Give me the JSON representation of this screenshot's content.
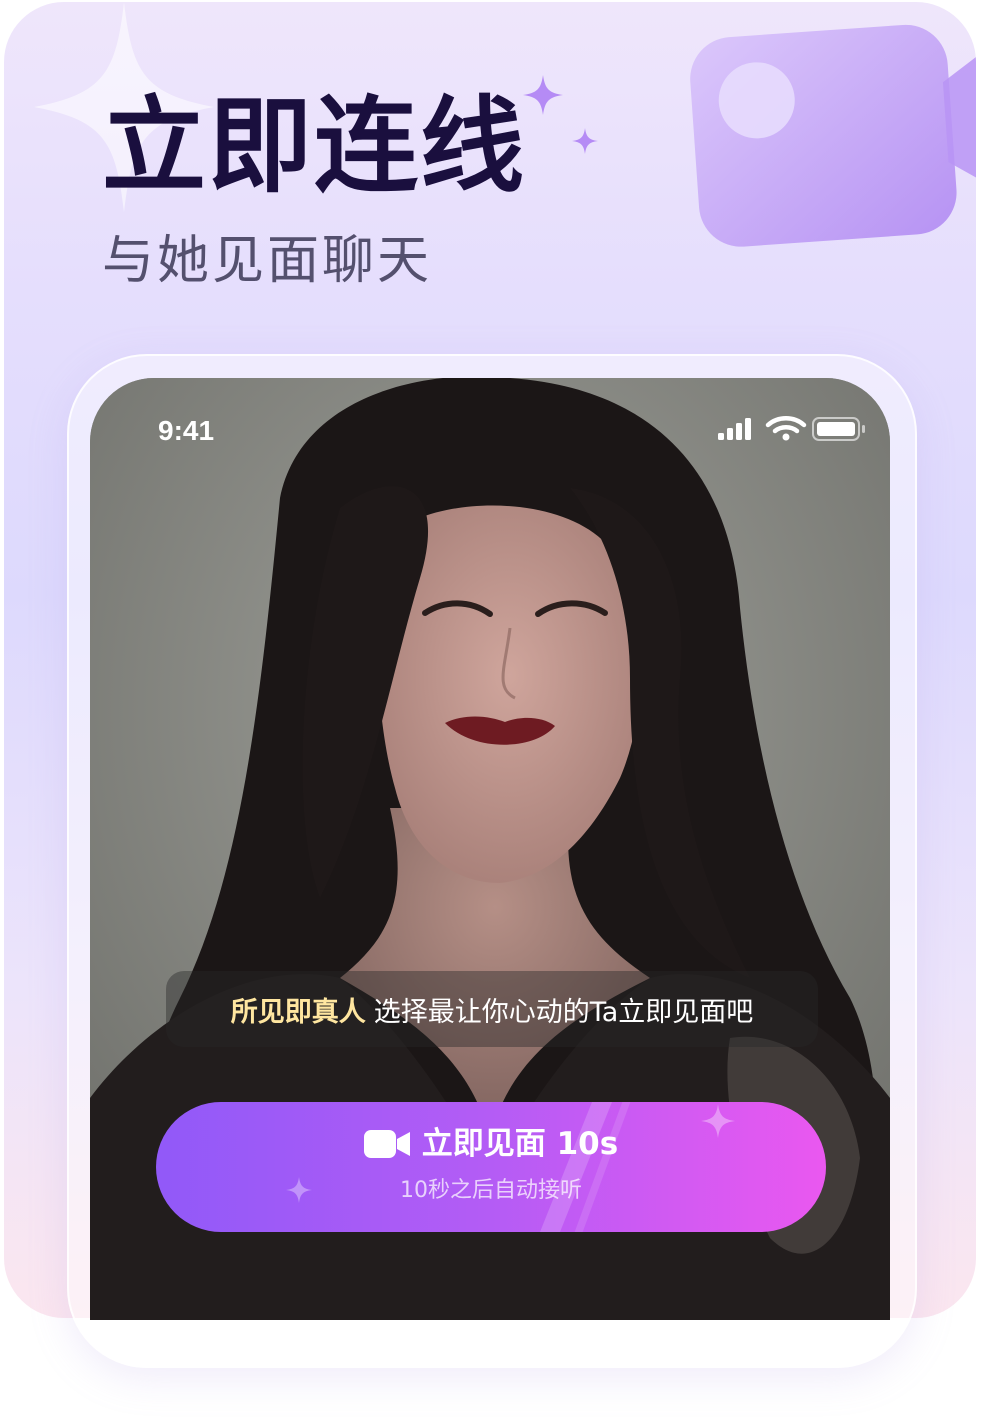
{
  "promo": {
    "headline": "立即连线",
    "subheadline": "与她见面聊天"
  },
  "status_bar": {
    "time": "9:41",
    "icons": [
      "signal-icon",
      "wifi-icon",
      "battery-icon"
    ]
  },
  "caption": {
    "highlight": "所见即真人",
    "text": "选择最让你心动的Ta立即见面吧"
  },
  "cta": {
    "label": "立即见面 10s",
    "sublabel": "10秒之后自动接听",
    "icon": "video-camera-icon"
  },
  "colors": {
    "headline": "#1a0f3e",
    "subheadline": "#54506e",
    "caption_highlight": "#ffe6a0",
    "cta_gradient_start": "#9159f8",
    "cta_gradient_end": "#ea58f0",
    "accent_purple": "#b88cf5"
  }
}
